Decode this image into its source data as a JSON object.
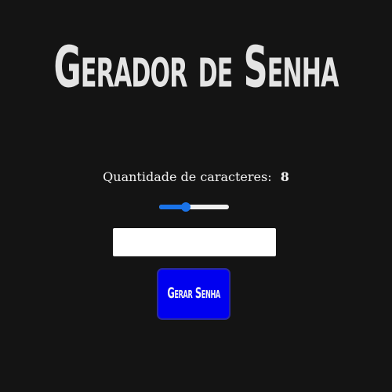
{
  "header": {
    "title": "Gerador de Senha"
  },
  "settings": {
    "length_label": "Quantidade de caracteres:",
    "length_value": "8",
    "slider_fraction": 0.38
  },
  "password": {
    "value": "",
    "placeholder": ""
  },
  "actions": {
    "generate_label": "Gerar Senha"
  },
  "colors": {
    "background": "#141414",
    "title": "#e4e4e4",
    "accent": "#1a73e8",
    "button": "#0000f0"
  }
}
